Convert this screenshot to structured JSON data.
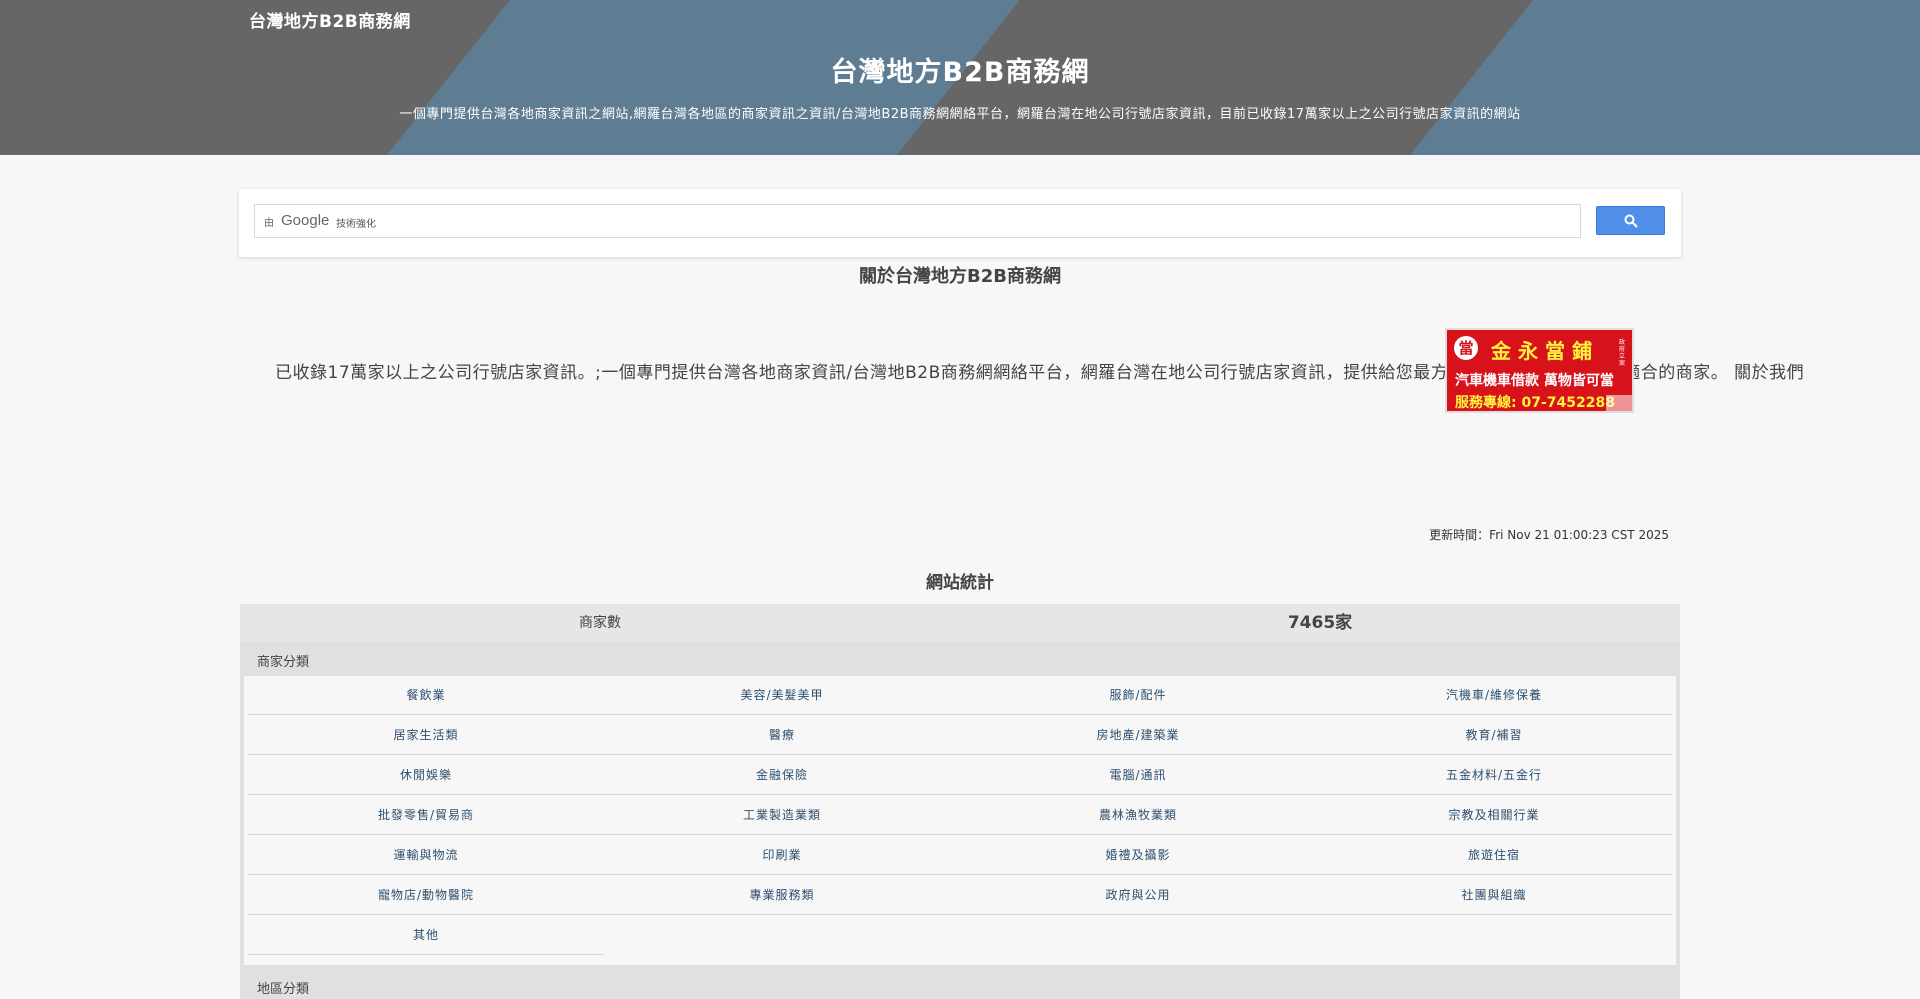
{
  "site": {
    "brand": "台灣地方B2B商務網",
    "title": "台灣地方B2B商務網",
    "subtitle": "一個專門提供台灣各地商家資訊之網站,網羅台灣各地區的商家資訊之資訊/台灣地B2B商務網網絡平台，網羅台灣在地公司行號店家資訊，目前已收錄17萬家以上之公司行號店家資訊的網站"
  },
  "search": {
    "prefix": "由",
    "google": "Google",
    "enhanced": "技術強化",
    "button_icon": "search-icon"
  },
  "about": {
    "heading": "關於台灣地方B2B商務網",
    "intro": "已收錄17萬家以上之公司行號店家資訊。;一個專門提供台灣各地商家資訊/台灣地B2B商務網網絡平台，網羅台灣在地公司行號店家資訊，提供給您最方便的查詢，讓您找到最適合的商家。 關於我們"
  },
  "ad": {
    "seal": "當",
    "name": "金永當鋪",
    "tag": "政府立案",
    "line1": "汽車機車借款  萬物皆可當",
    "line2": "服務專線: 07-7452288"
  },
  "update": {
    "text": "更新時間：Fri Nov 21 01:00:23 CST 2025"
  },
  "stats": {
    "heading": "網站統計",
    "label": "商家數",
    "value": "7465家"
  },
  "categories": {
    "heading": "商家分類",
    "items": [
      "餐飲業",
      "美容/美髮美甲",
      "服飾/配件",
      "汽機車/維修保養",
      "居家生活類",
      "醫療",
      "房地產/建築業",
      "教育/補習",
      "休閒娛樂",
      "金融保險",
      "電腦/通訊",
      "五金材料/五金行",
      "批發零售/貿易商",
      "工業製造業類",
      "農林漁牧業類",
      "宗教及相關行業",
      "運輸與物流",
      "印刷業",
      "婚禮及攝影",
      "旅遊住宿",
      "寵物店/動物醫院",
      "專業服務類",
      "政府與公用",
      "社團與組織",
      "其他"
    ]
  },
  "regions": {
    "heading": "地區分類"
  },
  "colors": {
    "hero_gray": "#666666",
    "hero_blue": "#5e7d92",
    "search_button": "#4f8fe8",
    "ad_red": "#d8121b",
    "link": "#2f4f6f"
  }
}
